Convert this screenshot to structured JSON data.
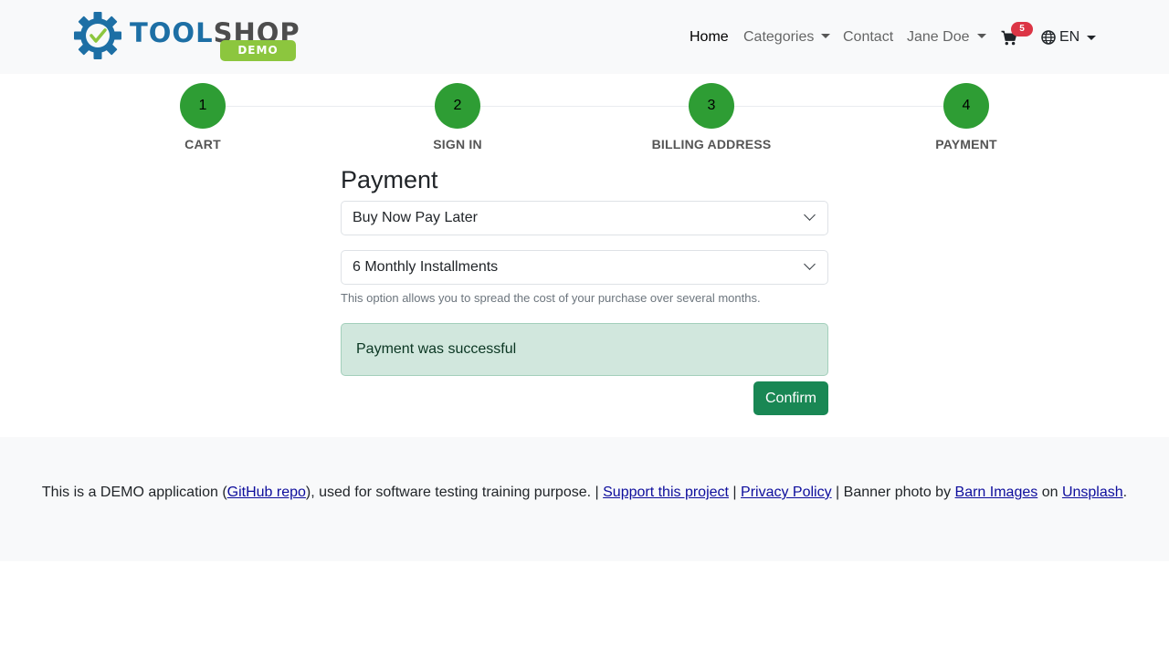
{
  "brand": {
    "word_tool": "TOOL",
    "word_shop": "SHOP",
    "badge": "DEMO",
    "colors": {
      "gear": "#1d6fa5",
      "check": "#8cc63e",
      "shop": "#4d4d4d"
    }
  },
  "nav": {
    "home": "Home",
    "categories": "Categories",
    "contact": "Contact",
    "user": "Jane Doe",
    "cart_count": "5",
    "language": "EN",
    "icons": {
      "cart": "cart-icon",
      "globe": "globe-icon"
    }
  },
  "steps": [
    {
      "number": "1",
      "label": "CART"
    },
    {
      "number": "2",
      "label": "SIGN IN"
    },
    {
      "number": "3",
      "label": "BILLING ADDRESS"
    },
    {
      "number": "4",
      "label": "PAYMENT"
    }
  ],
  "payment": {
    "title": "Payment",
    "method_selected": "Buy Now Pay Later",
    "plan_selected": "6 Monthly Installments",
    "help_text": "This option allows you to spread the cost of your purchase over several months.",
    "alert": "Payment was successful",
    "confirm_label": "Confirm"
  },
  "footer": {
    "text_1": "This is a DEMO application (",
    "link_github": "GitHub repo",
    "text_2": "), used for software testing training purpose. | ",
    "link_support": "Support this project",
    "text_3": " | ",
    "link_privacy": "Privacy Policy",
    "text_4": " | Banner photo by ",
    "link_barn": "Barn Images",
    "text_5": " on ",
    "link_unsplash": "Unsplash",
    "text_6": "."
  },
  "colors": {
    "step_green": "#2e9d34",
    "success_bg": "#d1e7dd",
    "confirm_green": "#198754",
    "badge_red": "#dc3545"
  }
}
